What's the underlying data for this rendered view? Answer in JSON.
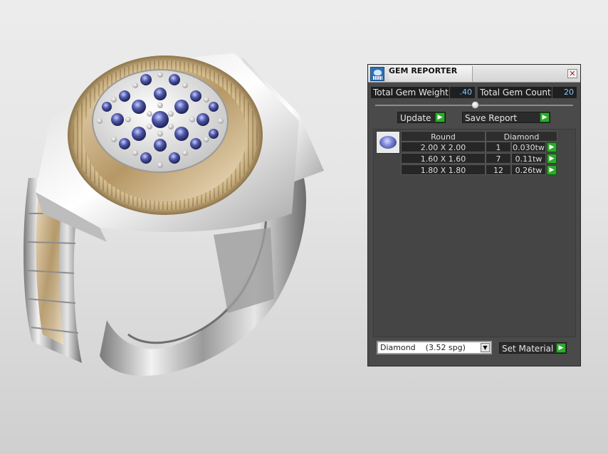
{
  "window": {
    "title": "GEM REPORTER",
    "close_icon": "close-icon"
  },
  "totals": {
    "weight_label": "Total Gem Weight",
    "weight_value": ".40",
    "count_label": "Total Gem Count",
    "count_value": "20"
  },
  "actions": {
    "update_label": "Update",
    "save_label": "Save Report",
    "set_material_label": "Set Material"
  },
  "table": {
    "columns": [
      "Round",
      "Diamond"
    ],
    "rows": [
      {
        "size": "2.00 X 2.00",
        "count": "1",
        "weight": "0.030tw"
      },
      {
        "size": "1.60 X 1.60",
        "count": "7",
        "weight": "0.11tw"
      },
      {
        "size": "1.80 X 1.80",
        "count": "12",
        "weight": "0.26tw"
      }
    ]
  },
  "material": {
    "selected": "Diamond    (3.52 spg)"
  },
  "colors": {
    "accent_green": "#2eaa2e",
    "value_blue": "#7ec9ff",
    "panel_bg": "#4a4a4a"
  }
}
